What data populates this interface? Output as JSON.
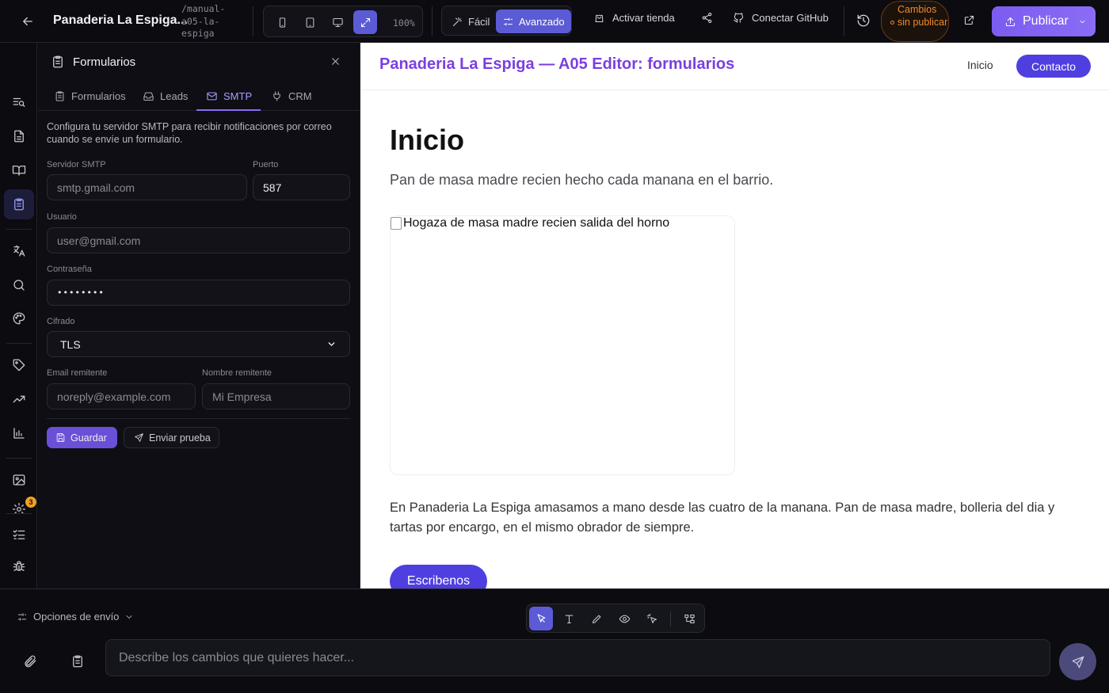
{
  "topbar": {
    "project_title": "Panaderia La Espiga...",
    "project_slug": "/manual-a05-la-espiga",
    "zoom": "100%",
    "mode_easy": "Fácil",
    "mode_advanced": "Avanzado",
    "activate_store": "Activar tienda",
    "connect_github": "Conectar GitHub",
    "unsaved": "Cambios sin publicar",
    "publish": "Publicar"
  },
  "panel": {
    "title": "Formularios",
    "tabs": [
      {
        "label": "Formularios"
      },
      {
        "label": "Leads"
      },
      {
        "label": "SMTP"
      },
      {
        "label": "CRM"
      }
    ],
    "active_tab": "SMTP",
    "description": "Configura tu servidor SMTP para recibir notificaciones por correo cuando se envíe un formulario.",
    "smtp_server": {
      "label": "Servidor SMTP",
      "placeholder": "smtp.gmail.com",
      "value": ""
    },
    "port": {
      "label": "Puerto",
      "value": "587"
    },
    "user": {
      "label": "Usuario",
      "placeholder": "user@gmail.com",
      "value": ""
    },
    "password": {
      "label": "Contraseña",
      "value": "••••••••"
    },
    "encryption": {
      "label": "Cifrado",
      "value": "TLS"
    },
    "sender_email": {
      "label": "Email remitente",
      "placeholder": "noreply@example.com"
    },
    "sender_name": {
      "label": "Nombre remitente",
      "placeholder": "Mi Empresa"
    },
    "save": "Guardar",
    "send_test": "Enviar prueba"
  },
  "rail": {
    "badge_count": "3"
  },
  "preview": {
    "brand": "Panaderia La Espiga — A05 Editor: formularios",
    "nav_home": "Inicio",
    "nav_contact": "Contacto",
    "heading": "Inicio",
    "lead": "Pan de masa madre recien hecho cada manana en el barrio.",
    "image_alt": "Hogaza de masa madre recien salida del horno",
    "body": "En Panaderia La Espiga amasamos a mano desde las cuatro de la manana. Pan de masa madre, bolleria del dia y tartas por encargo, en el mismo obrador de siempre.",
    "cta": "Escribenos"
  },
  "bottom": {
    "send_options": "Opciones de envío",
    "prompt_placeholder": "Describe los cambios que quieres hacer..."
  },
  "colors": {
    "accent": "#5b5bd6",
    "brand_purple": "#7b3fe0",
    "site_cta": "#4f3fe0",
    "unsaved_orange": "#f08a2a"
  }
}
